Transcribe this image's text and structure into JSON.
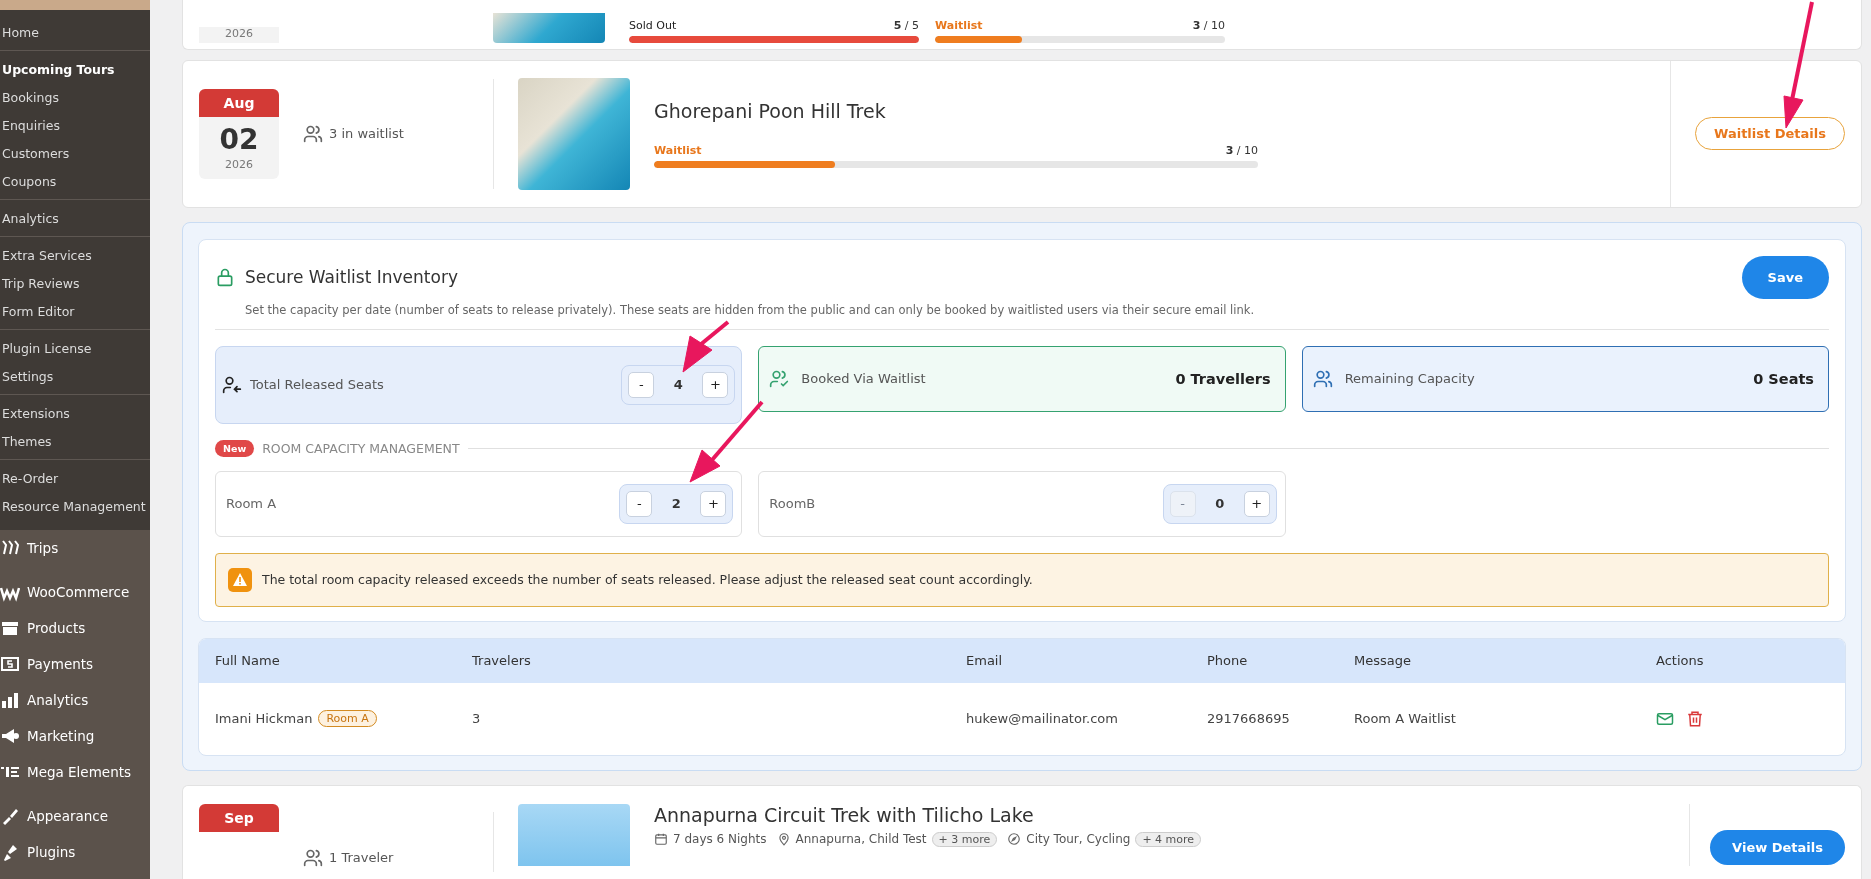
{
  "sidebar": {
    "groups": [
      [
        {
          "label": "Home",
          "selected": false
        }
      ],
      [
        {
          "label": "Upcoming Tours",
          "selected": true
        },
        {
          "label": "Bookings",
          "selected": false
        },
        {
          "label": "Enquiries",
          "selected": false
        },
        {
          "label": "Customers",
          "selected": false
        },
        {
          "label": "Coupons",
          "selected": false
        }
      ],
      [
        {
          "label": "Analytics",
          "selected": false
        }
      ],
      [
        {
          "label": "Extra Services",
          "selected": false
        },
        {
          "label": "Trip Reviews",
          "selected": false
        },
        {
          "label": "Form Editor",
          "selected": false
        }
      ],
      [
        {
          "label": "Plugin License",
          "selected": false
        },
        {
          "label": "Settings",
          "selected": false
        }
      ],
      [
        {
          "label": "Extensions",
          "selected": false
        },
        {
          "label": "Themes",
          "selected": false
        }
      ],
      [
        {
          "label": "Re-Order",
          "selected": false
        },
        {
          "label": "Resource Management",
          "selected": false
        }
      ]
    ],
    "menu": [
      "Trips",
      "WooCommerce",
      "Products",
      "Payments",
      "Analytics",
      "Marketing",
      "Mega Elements",
      "Appearance",
      "Plugins"
    ]
  },
  "partial_tour": {
    "year": "2026",
    "bars": [
      {
        "kind": "soldout",
        "label": "Sold Out",
        "count": "**5** / 5",
        "level": 1
      },
      {
        "kind": "waitlist",
        "label": "Waitlist",
        "count": "**3** / 10",
        "level": 0.3
      }
    ]
  },
  "tour": {
    "month": "Aug",
    "day": "02",
    "year": "2026",
    "waitlist": "3 in waitlist",
    "title": "Ghorepani Poon Hill Trek",
    "bars": [
      {
        "kind": "waitlist",
        "label": "Waitlist",
        "count": "**3** / 10",
        "level": 0.3
      }
    ],
    "button": "Waitlist Details"
  },
  "inventory": {
    "title": "Secure Waitlist Inventory",
    "description": "Set the capacity per date (number of seats to release privately). These seats are hidden from the public and can only be booked by waitlisted users via their secure email link.",
    "save": "Save",
    "stats": [
      {
        "kind": "stepper",
        "label": "Total Released Seats",
        "value": "4",
        "minus": "-",
        "plus": "+",
        "minus_disabled": false
      },
      {
        "kind": "booked",
        "label": "Booked Via Waitlist",
        "value": "0 Travellers"
      },
      {
        "kind": "remaining",
        "label": "Remaining Capacity",
        "value": "0 Seats"
      }
    ],
    "badge": "New",
    "rooms_heading": "ROOM CAPACITY MANAGEMENT",
    "rooms": [
      {
        "name": "Room A",
        "value": "2",
        "minus": "-",
        "plus": "+",
        "minus_disabled": false
      },
      {
        "name": "RoomB",
        "value": "0",
        "minus": "-",
        "plus": "+",
        "minus_disabled": true
      }
    ],
    "warning": "The total room capacity released exceeds the number of seats released. Please adjust the released seat count accordingly."
  },
  "table": {
    "columns": [
      "Full Name",
      "Travelers",
      "Email",
      "Phone",
      "Message",
      "Actions"
    ],
    "rows": [
      {
        "full_name": "Imani Hickman",
        "tag": "Room A",
        "travelers": "3",
        "email": "hukew@mailinator.com",
        "phone": "2917668695",
        "message": "Room A Waitlist"
      }
    ]
  },
  "next_tour": {
    "month": "Sep",
    "travelers": "1 Traveler",
    "title": "Annapurna Circuit Trek with Tilicho Lake",
    "duration": "7 days 6 Nights",
    "places": "Annapurna, Child Test",
    "places_more": "+ 3 more",
    "activities": "City Tour, Cycling",
    "activities_more": "+ 4 more",
    "button": "View Details"
  }
}
